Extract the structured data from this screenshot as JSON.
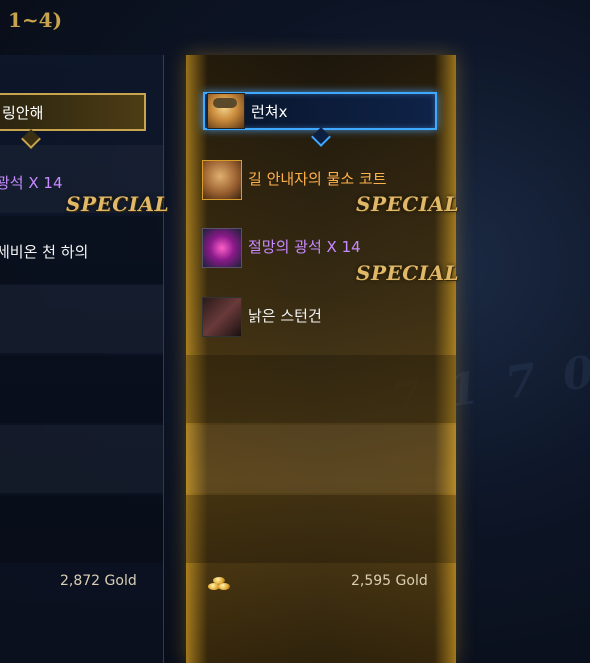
{
  "header": {
    "title_fragment": "1~4)"
  },
  "background_text": "7 1 7 0",
  "left_column": {
    "selector_text": "링안해",
    "items": [
      {
        "name": "광석 X 14",
        "color": "#c78aff",
        "special": "SPECIAL"
      },
      {
        "name": "세비온 천 하의",
        "color": "#f4f4f4"
      }
    ],
    "price": "2,872 Gold"
  },
  "right_column": {
    "selector_text": "런쳐x",
    "items": [
      {
        "icon": "coat-icon",
        "name": "길 안내자의 물소 코트",
        "color": "#ffb14a",
        "special": "SPECIAL"
      },
      {
        "icon": "gem-icon",
        "name": "절망의 광석 X 14",
        "color": "#c78aff",
        "special": "SPECIAL"
      },
      {
        "icon": "gun-icon",
        "name": "낡은 스턴건",
        "color": "#f4f4f4"
      }
    ],
    "price": "2,595 Gold"
  },
  "colors": {
    "accent_gold": "#c9a44e",
    "accent_blue": "#3fa9ff"
  }
}
